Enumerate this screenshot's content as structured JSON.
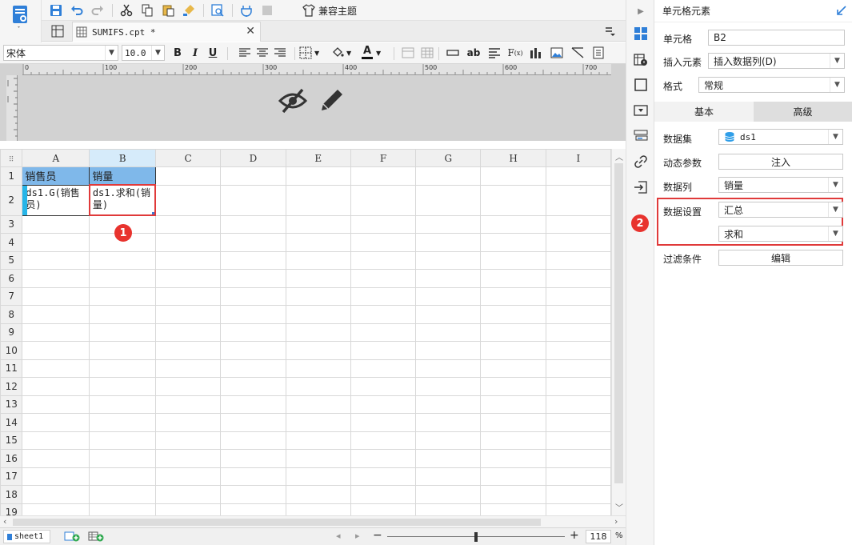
{
  "toolbar": {
    "compat_theme_label": "兼容主题"
  },
  "tab": {
    "filename": "SUMIFS.cpt *"
  },
  "font": {
    "family": "宋体",
    "size": "10.0"
  },
  "ruler": {
    "ticks": [
      "0",
      "100",
      "200",
      "300",
      "400",
      "500",
      "600",
      "700"
    ]
  },
  "sheet": {
    "columns": [
      "A",
      "B",
      "C",
      "D",
      "E",
      "F",
      "G",
      "H",
      "I"
    ],
    "rows": [
      "1",
      "2",
      "3",
      "4",
      "5",
      "6",
      "7",
      "8",
      "9",
      "10",
      "11",
      "12",
      "13",
      "14",
      "15",
      "16",
      "17",
      "18",
      "19"
    ],
    "cells": {
      "A1": "销售员",
      "B1": "销量",
      "A2": "ds1.G(销售员)",
      "B2": "ds1.求和(销量)"
    }
  },
  "status": {
    "sheet_name": "sheet1",
    "zoom": "118",
    "zoom_unit": "%"
  },
  "panel": {
    "title": "单元格元素",
    "cell_label": "单元格",
    "cell_value": "B2",
    "insert_label": "插入元素",
    "insert_value": "插入数据列(D)",
    "format_label": "格式",
    "format_value": "常规",
    "tab_basic": "基本",
    "tab_advanced": "高级",
    "dataset_label": "数据集",
    "dataset_value": "ds1",
    "dyn_param_label": "动态参数",
    "dyn_param_button": "注入",
    "column_label": "数据列",
    "column_value": "销量",
    "data_setting_label": "数据设置",
    "data_setting_value": "汇总",
    "aggregate_value": "求和",
    "filter_label": "过滤条件",
    "filter_button": "编辑"
  },
  "badges": {
    "one": "1",
    "two": "2"
  },
  "colors": {
    "header_fill": "#7fb8ea",
    "accent": "#1e6fd8",
    "highlight_red": "#e03a3a"
  }
}
